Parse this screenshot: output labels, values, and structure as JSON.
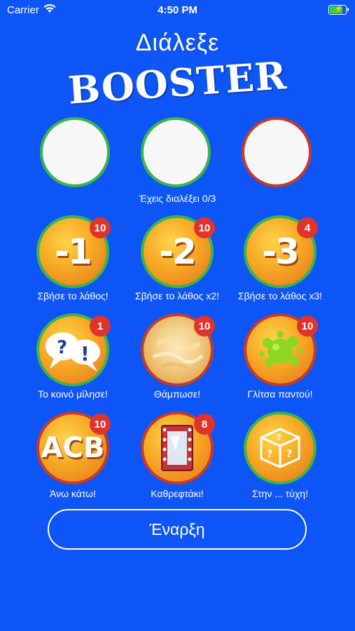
{
  "status_bar": {
    "carrier": "Carrier",
    "time": "4:50 PM"
  },
  "header": {
    "title_line1": "Διάλεξε",
    "title_line2": "BOOSTER"
  },
  "selected": {
    "count_text": "Έχεις διαλέξει 0/3"
  },
  "boosters": [
    {
      "label": "Σβήσε το λάθος!",
      "badge": "10",
      "icon": "minus-one-icon",
      "glyph": "-1"
    },
    {
      "label": "Σβήσε το λάθος x2!",
      "badge": "10",
      "icon": "minus-two-icon",
      "glyph": "-2"
    },
    {
      "label": "Σβήσε το λάθος x3!",
      "badge": "4",
      "icon": "minus-three-icon",
      "glyph": "-3"
    },
    {
      "label": "Το κοινό μίλησε!",
      "badge": "1",
      "icon": "speech-bubbles-icon",
      "glyph": "?!"
    },
    {
      "label": "Θάμπωσε!",
      "badge": "10",
      "icon": "blur-icon",
      "glyph": ""
    },
    {
      "label": "Γλίτσα παντού!",
      "badge": "10",
      "icon": "slime-splat-icon",
      "glyph": ""
    },
    {
      "label": "Άνω κάτω!",
      "badge": "10",
      "icon": "upside-down-icon",
      "glyph": "ACB"
    },
    {
      "label": "Καθρεφτάκι!",
      "badge": "8",
      "icon": "mirror-icon",
      "glyph": ""
    },
    {
      "label": "Στην ... τύχη!",
      "badge": "",
      "icon": "mystery-box-icon",
      "glyph": "?"
    }
  ],
  "start_button": {
    "label": "Έναρξη"
  },
  "colors": {
    "background": "#0d55f5",
    "green_ring": "#3cb44a",
    "red_ring": "#c63a2a",
    "badge": "#e0332b"
  }
}
